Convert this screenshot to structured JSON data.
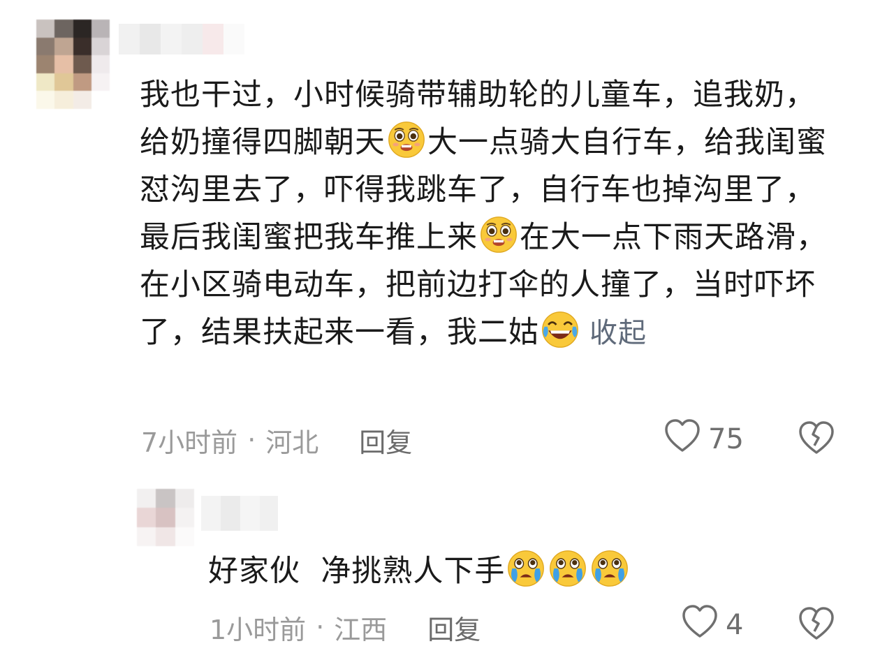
{
  "comments": [
    {
      "text_parts": [
        "我也干过，小时候骑带辅助轮的儿童车，追我奶，给奶撞得四脚朝天",
        "大一点骑大自行车，给我闺蜜怼沟里去了，吓得我跳车了，自行车也掉沟里了，最后我闺蜜把我车推上来",
        "在大一点下雨天路滑，在小区骑电动车，把前边打伞的人撞了，当时吓坏了，结果扶起来一看，我二姑"
      ],
      "emojis": [
        "pleading-face-icon",
        "pleading-face-icon",
        "laughing-tears-face-icon"
      ],
      "collapse_label": "收起",
      "time": "7小时前",
      "dot": "·",
      "location": "河北",
      "reply_label": "回复",
      "like_count": "75"
    },
    {
      "text_parts": [
        "好家伙  净挑熟人下手"
      ],
      "emojis": [
        "crying-face-icon",
        "crying-face-icon",
        "crying-face-icon"
      ],
      "time": "1小时前",
      "dot": "·",
      "location": "江西",
      "reply_label": "回复",
      "like_count": "4"
    }
  ],
  "colors": {
    "text": "#1a1a1a",
    "meta": "#9a9a9a",
    "collapse": "#5f6a7a",
    "emoji_yellow": "#f9c93a"
  }
}
